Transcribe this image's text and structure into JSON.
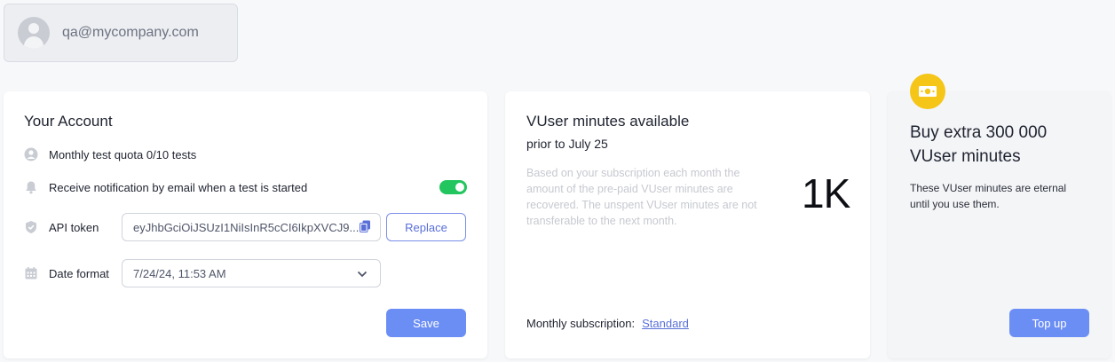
{
  "user": {
    "email": "qa@mycompany.com"
  },
  "account": {
    "title": "Your Account",
    "quota_label": "Monthly test quota 0/10 tests",
    "notification_label": "Receive notification by email when a test is started",
    "notification_enabled": true,
    "api_token_label": "API token",
    "api_token_value": "eyJhbGciOiJSUzI1NiIsInR5cCI6IkpXVCJ9...",
    "replace_label": "Replace",
    "date_format_label": "Date format",
    "date_format_value": "7/24/24, 11:53 AM",
    "save_label": "Save"
  },
  "vuser": {
    "title": "VUser minutes available",
    "subtitle": "prior to July 25",
    "description": "Based on your subscription each month the amount of the pre-paid VUser minutes are recovered. The unspent VUser minutes are not transferable to the next month.",
    "amount": "1K",
    "subscription_label": "Monthly subscription:",
    "subscription_value": "Standard"
  },
  "buy": {
    "title": "Buy extra 300 000 VUser minutes",
    "text": "These VUser minutes are eternal until you use them.",
    "topup_label": "Top up"
  },
  "colors": {
    "accent": "#6b8ef5",
    "toggle_on": "#22c55e",
    "badge": "#f5c518"
  }
}
